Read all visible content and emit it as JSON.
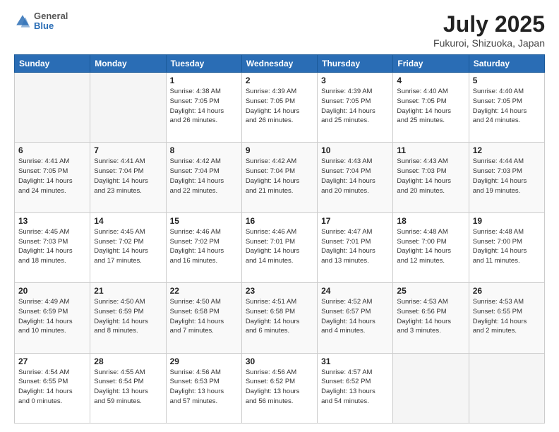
{
  "header": {
    "logo_general": "General",
    "logo_blue": "Blue",
    "title": "July 2025",
    "subtitle": "Fukuroi, Shizuoka, Japan"
  },
  "days_of_week": [
    "Sunday",
    "Monday",
    "Tuesday",
    "Wednesday",
    "Thursday",
    "Friday",
    "Saturday"
  ],
  "weeks": [
    [
      {
        "day": "",
        "empty": true
      },
      {
        "day": "",
        "empty": true
      },
      {
        "day": "1",
        "sunrise": "4:38 AM",
        "sunset": "7:05 PM",
        "daylight": "14 hours and 26 minutes."
      },
      {
        "day": "2",
        "sunrise": "4:39 AM",
        "sunset": "7:05 PM",
        "daylight": "14 hours and 26 minutes."
      },
      {
        "day": "3",
        "sunrise": "4:39 AM",
        "sunset": "7:05 PM",
        "daylight": "14 hours and 25 minutes."
      },
      {
        "day": "4",
        "sunrise": "4:40 AM",
        "sunset": "7:05 PM",
        "daylight": "14 hours and 25 minutes."
      },
      {
        "day": "5",
        "sunrise": "4:40 AM",
        "sunset": "7:05 PM",
        "daylight": "14 hours and 24 minutes."
      }
    ],
    [
      {
        "day": "6",
        "sunrise": "4:41 AM",
        "sunset": "7:05 PM",
        "daylight": "14 hours and 24 minutes."
      },
      {
        "day": "7",
        "sunrise": "4:41 AM",
        "sunset": "7:04 PM",
        "daylight": "14 hours and 23 minutes."
      },
      {
        "day": "8",
        "sunrise": "4:42 AM",
        "sunset": "7:04 PM",
        "daylight": "14 hours and 22 minutes."
      },
      {
        "day": "9",
        "sunrise": "4:42 AM",
        "sunset": "7:04 PM",
        "daylight": "14 hours and 21 minutes."
      },
      {
        "day": "10",
        "sunrise": "4:43 AM",
        "sunset": "7:04 PM",
        "daylight": "14 hours and 20 minutes."
      },
      {
        "day": "11",
        "sunrise": "4:43 AM",
        "sunset": "7:03 PM",
        "daylight": "14 hours and 20 minutes."
      },
      {
        "day": "12",
        "sunrise": "4:44 AM",
        "sunset": "7:03 PM",
        "daylight": "14 hours and 19 minutes."
      }
    ],
    [
      {
        "day": "13",
        "sunrise": "4:45 AM",
        "sunset": "7:03 PM",
        "daylight": "14 hours and 18 minutes."
      },
      {
        "day": "14",
        "sunrise": "4:45 AM",
        "sunset": "7:02 PM",
        "daylight": "14 hours and 17 minutes."
      },
      {
        "day": "15",
        "sunrise": "4:46 AM",
        "sunset": "7:02 PM",
        "daylight": "14 hours and 16 minutes."
      },
      {
        "day": "16",
        "sunrise": "4:46 AM",
        "sunset": "7:01 PM",
        "daylight": "14 hours and 14 minutes."
      },
      {
        "day": "17",
        "sunrise": "4:47 AM",
        "sunset": "7:01 PM",
        "daylight": "14 hours and 13 minutes."
      },
      {
        "day": "18",
        "sunrise": "4:48 AM",
        "sunset": "7:00 PM",
        "daylight": "14 hours and 12 minutes."
      },
      {
        "day": "19",
        "sunrise": "4:48 AM",
        "sunset": "7:00 PM",
        "daylight": "14 hours and 11 minutes."
      }
    ],
    [
      {
        "day": "20",
        "sunrise": "4:49 AM",
        "sunset": "6:59 PM",
        "daylight": "14 hours and 10 minutes."
      },
      {
        "day": "21",
        "sunrise": "4:50 AM",
        "sunset": "6:59 PM",
        "daylight": "14 hours and 8 minutes."
      },
      {
        "day": "22",
        "sunrise": "4:50 AM",
        "sunset": "6:58 PM",
        "daylight": "14 hours and 7 minutes."
      },
      {
        "day": "23",
        "sunrise": "4:51 AM",
        "sunset": "6:58 PM",
        "daylight": "14 hours and 6 minutes."
      },
      {
        "day": "24",
        "sunrise": "4:52 AM",
        "sunset": "6:57 PM",
        "daylight": "14 hours and 4 minutes."
      },
      {
        "day": "25",
        "sunrise": "4:53 AM",
        "sunset": "6:56 PM",
        "daylight": "14 hours and 3 minutes."
      },
      {
        "day": "26",
        "sunrise": "4:53 AM",
        "sunset": "6:55 PM",
        "daylight": "14 hours and 2 minutes."
      }
    ],
    [
      {
        "day": "27",
        "sunrise": "4:54 AM",
        "sunset": "6:55 PM",
        "daylight": "14 hours and 0 minutes."
      },
      {
        "day": "28",
        "sunrise": "4:55 AM",
        "sunset": "6:54 PM",
        "daylight": "13 hours and 59 minutes."
      },
      {
        "day": "29",
        "sunrise": "4:56 AM",
        "sunset": "6:53 PM",
        "daylight": "13 hours and 57 minutes."
      },
      {
        "day": "30",
        "sunrise": "4:56 AM",
        "sunset": "6:52 PM",
        "daylight": "13 hours and 56 minutes."
      },
      {
        "day": "31",
        "sunrise": "4:57 AM",
        "sunset": "6:52 PM",
        "daylight": "13 hours and 54 minutes."
      },
      {
        "day": "",
        "empty": true
      },
      {
        "day": "",
        "empty": true
      }
    ]
  ],
  "labels": {
    "sunrise": "Sunrise:",
    "sunset": "Sunset:",
    "daylight": "Daylight:"
  }
}
